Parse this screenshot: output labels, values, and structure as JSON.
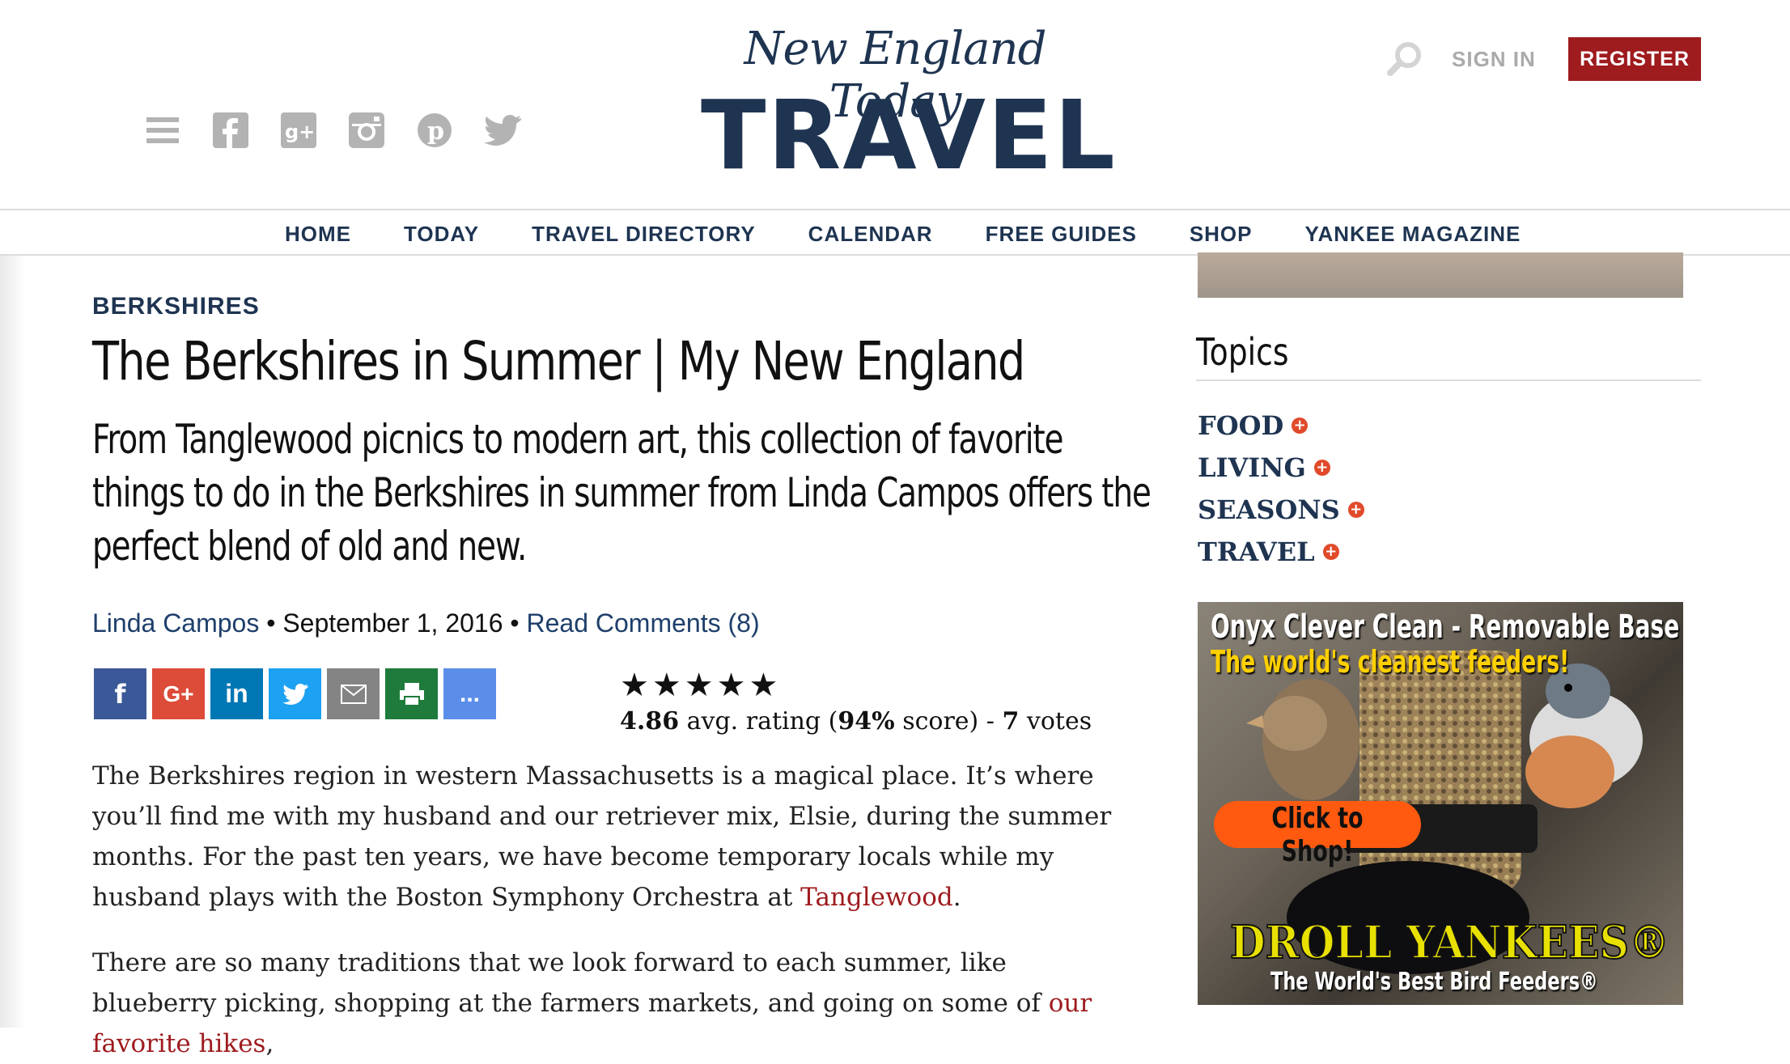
{
  "header": {
    "logo_script": "New England Today",
    "logo_main": "TRAVEL",
    "sign_in": "SIGN IN",
    "register": "REGISTER",
    "social_icons": [
      "menu-icon",
      "facebook-icon",
      "google-plus-icon",
      "instagram-icon",
      "pinterest-icon",
      "twitter-icon"
    ]
  },
  "nav": {
    "items": [
      "HOME",
      "TODAY",
      "TRAVEL DIRECTORY",
      "CALENDAR",
      "FREE GUIDES",
      "SHOP",
      "YANKEE MAGAZINE"
    ]
  },
  "article": {
    "kicker": "BERKSHIRES",
    "title": "The Berkshires in Summer | My New England",
    "dek": "From Tanglewood picnics to modern art, this collection of favorite things to do in the Berkshires in summer from Linda Campos offers the perfect blend of old and new.",
    "author": "Linda Campos",
    "date": "September 1, 2016",
    "comments": "Read Comments (8)",
    "share_buttons": [
      "f",
      "G+",
      "in",
      "twitter",
      "email",
      "print",
      "..."
    ],
    "rating": {
      "stars": 5,
      "avg": "4.86",
      "avg_label": "avg. rating (",
      "score": "94%",
      "score_label": "score) -",
      "votes": "7",
      "votes_label": "votes"
    },
    "p1_text": "The Berkshires region in western Massachusetts is a magical place. It’s where you’ll find me with my husband and our retriever mix, Elsie, during the summer months. For the past ten years, we have become temporary locals while my husband plays with the Boston Symphony Orchestra at ",
    "p1_link": "Tanglewood",
    "p1_end": ".",
    "p2_text": "There are so many traditions that we look forward to each summer, like blueberry picking, shopping at the farmers markets, and going on some of ",
    "p2_link": "our favorite hikes",
    "p2_end": ","
  },
  "sidebar": {
    "topics_heading": "Topics",
    "topics": [
      "FOOD",
      "LIVING",
      "SEASONS",
      "TRAVEL"
    ],
    "ad": {
      "headline": "Onyx Clever Clean - Removable Base",
      "subhead": "The world's cleanest feeders!",
      "cta": "Click to Shop!",
      "brand": "DROLL YANKEES®",
      "tagline": "The World's Best Bird Feeders®"
    }
  },
  "colors": {
    "navy": "#1e3451",
    "register_red": "#9e1b1e",
    "link_red": "#9e1b1e",
    "plus_orange": "#e04a2a",
    "facebook": "#3b5998",
    "google_plus": "#dd4b39",
    "linkedin": "#0077b5",
    "twitter": "#1da1f2",
    "email": "#848484",
    "print": "#1e7b3c",
    "more": "#5b8ee8"
  }
}
